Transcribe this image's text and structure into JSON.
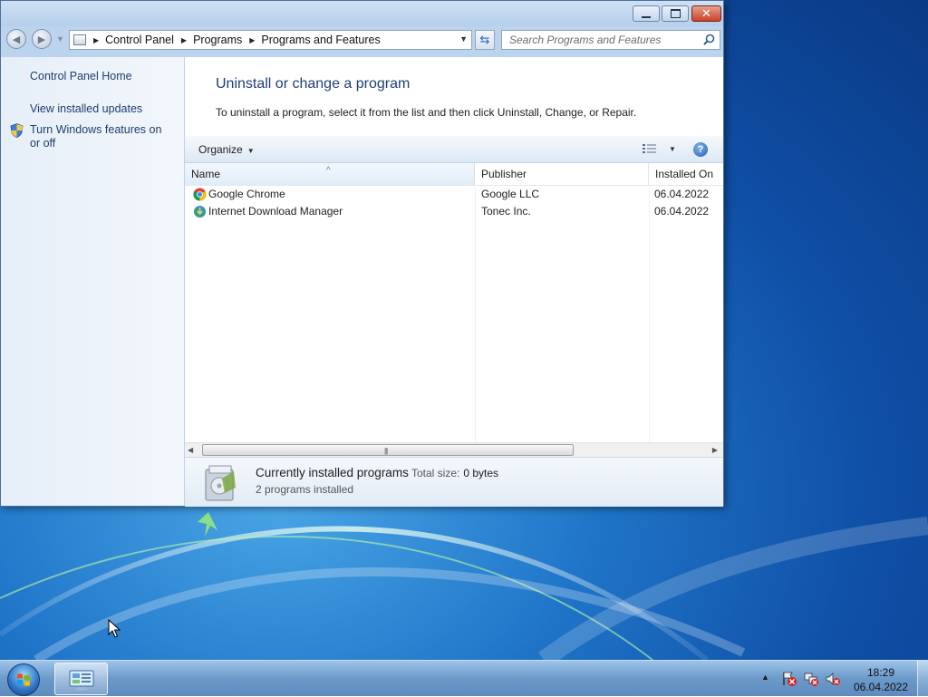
{
  "window": {
    "buttons": {
      "minimize": "minimize",
      "maximize": "maximize",
      "close": "close"
    }
  },
  "navbar": {
    "breadcrumbs": [
      "Control Panel",
      "Programs",
      "Programs and Features"
    ],
    "search_placeholder": "Search Programs and Features"
  },
  "sidebar": {
    "items": [
      {
        "label": "Control Panel Home"
      },
      {
        "label": "View installed updates"
      },
      {
        "label": "Turn Windows features on or off",
        "icon": "shield-icon"
      }
    ]
  },
  "main": {
    "title": "Uninstall or change a program",
    "description": "To uninstall a program, select it from the list and then click Uninstall, Change, or Repair.",
    "toolbar": {
      "organize_label": "Organize"
    },
    "columns": [
      "Name",
      "Publisher",
      "Installed On"
    ],
    "programs": [
      {
        "name": "Google Chrome",
        "publisher": "Google LLC",
        "installed_on": "06.04.2022",
        "icon": "chrome-icon"
      },
      {
        "name": "Internet Download Manager",
        "publisher": "Tonec Inc.",
        "installed_on": "06.04.2022",
        "icon": "idm-icon"
      }
    ]
  },
  "details": {
    "title": "Currently installed programs",
    "total_size_label": "Total size:",
    "total_size_value": "0 bytes",
    "count_text": "2 programs installed"
  },
  "taskbar": {
    "clock_time": "18:29",
    "clock_date": "06.04.2022"
  },
  "colors": {
    "link": "#1e3f6e",
    "title": "#1e3f74",
    "close_button": "#c7432a"
  }
}
